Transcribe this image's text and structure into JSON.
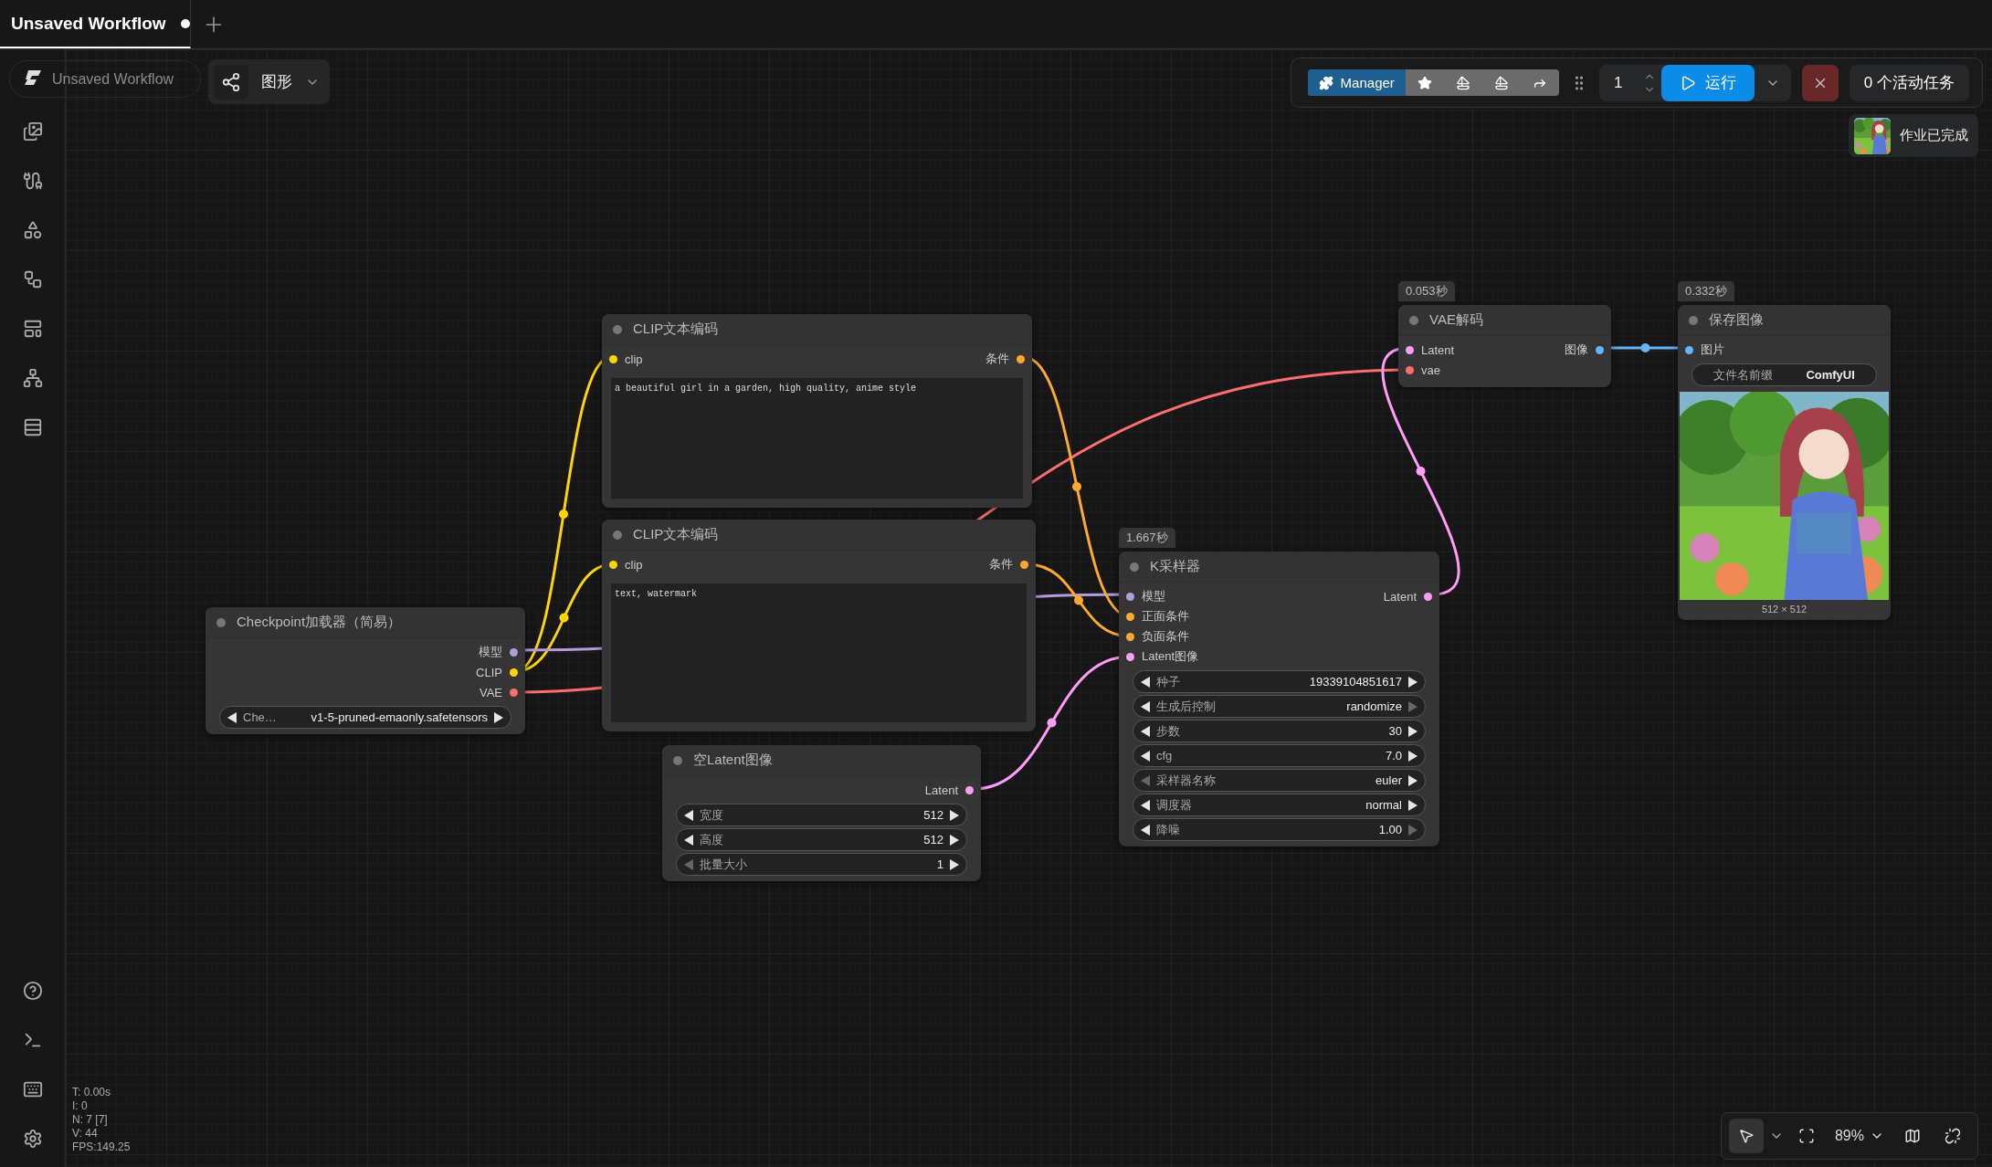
{
  "tab": {
    "title": "Unsaved Workflow",
    "selected": true,
    "modified": true
  },
  "breadcrumb": "Unsaved Workflow",
  "mode_button": {
    "label": "图形"
  },
  "toolbar": {
    "manager": "Manager",
    "queue_count": "1",
    "run": "运行",
    "active_tasks": "0 个活动任务"
  },
  "toast": {
    "message": "作业已完成"
  },
  "nodes": [
    {
      "title": "Checkpoint加载器（简易）",
      "outputs": [
        {
          "label": "模型",
          "color": "#b39ddb"
        },
        {
          "label": "CLIP",
          "color": "#ffd500"
        },
        {
          "label": "VAE",
          "color": "#ff6e6e"
        }
      ],
      "widgets": [
        {
          "kind": "stepper",
          "label": "Che…",
          "value": "v1-5-pruned-emaonly.safetensors",
          "prev_disabled": false,
          "next_disabled": false
        }
      ]
    },
    {
      "title": "CLIP文本编码",
      "inputs": [
        {
          "label": "clip",
          "color": "#ffd500"
        }
      ],
      "outputs": [
        {
          "label": "条件",
          "color": "#ffa931"
        }
      ],
      "prompt": "a beautiful girl in a garden, high quality, anime style"
    },
    {
      "title": "CLIP文本编码",
      "inputs": [
        {
          "label": "clip",
          "color": "#ffd500"
        }
      ],
      "outputs": [
        {
          "label": "条件",
          "color": "#ffa931"
        }
      ],
      "prompt": "text, watermark"
    },
    {
      "title": "空Latent图像",
      "outputs": [
        {
          "label": "Latent",
          "color": "#ff9cf9"
        }
      ],
      "widgets": [
        {
          "kind": "stepper",
          "label": "宽度",
          "value": "512",
          "prev_disabled": false,
          "next_disabled": false
        },
        {
          "kind": "stepper",
          "label": "高度",
          "value": "512",
          "prev_disabled": false,
          "next_disabled": false
        },
        {
          "kind": "stepper",
          "label": "批量大小",
          "value": "1",
          "prev_disabled": true,
          "next_disabled": false
        }
      ]
    },
    {
      "title": "K采样器",
      "timing": "1.667秒",
      "inputs": [
        {
          "label": "模型",
          "color": "#b39ddb"
        },
        {
          "label": "正面条件",
          "color": "#ffa931"
        },
        {
          "label": "负面条件",
          "color": "#ffa931"
        },
        {
          "label": "Latent图像",
          "color": "#ff9cf9"
        }
      ],
      "outputs": [
        {
          "label": "Latent",
          "color": "#ff9cf9"
        }
      ],
      "widgets": [
        {
          "kind": "stepper",
          "label": "种子",
          "value": "19339104851617",
          "prev_disabled": false,
          "next_disabled": false
        },
        {
          "kind": "stepper",
          "label": "生成后控制",
          "value": "randomize",
          "prev_disabled": false,
          "next_disabled": true
        },
        {
          "kind": "stepper",
          "label": "步数",
          "value": "30",
          "prev_disabled": false,
          "next_disabled": false
        },
        {
          "kind": "stepper",
          "label": "cfg",
          "value": "7.0",
          "prev_disabled": false,
          "next_disabled": false
        },
        {
          "kind": "stepper",
          "label": "采样器名称",
          "value": "euler",
          "prev_disabled": true,
          "next_disabled": false
        },
        {
          "kind": "stepper",
          "label": "调度器",
          "value": "normal",
          "prev_disabled": false,
          "next_disabled": false
        },
        {
          "kind": "stepper",
          "label": "降噪",
          "value": "1.00",
          "prev_disabled": false,
          "next_disabled": true
        }
      ]
    },
    {
      "title": "VAE解码",
      "timing": "0.053秒",
      "inputs": [
        {
          "label": "Latent",
          "color": "#ff9cf9"
        },
        {
          "label": "vae",
          "color": "#ff6e6e"
        }
      ],
      "outputs": [
        {
          "label": "图像",
          "color": "#64b5f6"
        }
      ]
    },
    {
      "title": "保存图像",
      "timing": "0.332秒",
      "inputs": [
        {
          "label": "图片",
          "color": "#64b5f6"
        }
      ],
      "widgets": [
        {
          "kind": "text",
          "label": "文件名前缀",
          "value": "ComfyUI"
        }
      ],
      "image": {
        "kind": "picture",
        "caption": "512 × 512"
      }
    }
  ],
  "stats": [
    "T: 0.00s",
    "I: 0",
    "N: 7 [7]",
    "V: 44",
    "FPS:149.25"
  ],
  "bottom_toolbar": {
    "pointer_selected": true,
    "zoom": "89%"
  }
}
